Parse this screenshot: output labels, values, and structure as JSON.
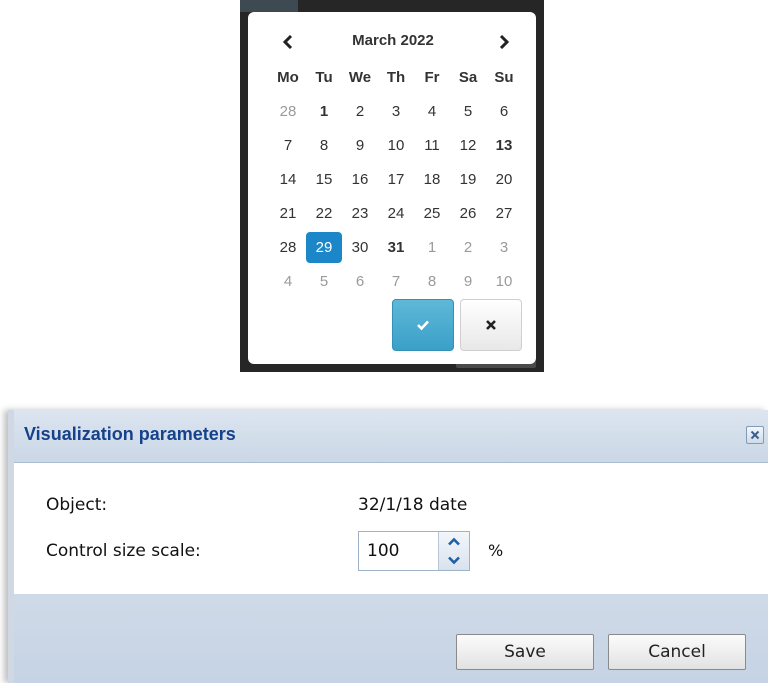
{
  "datepicker": {
    "month_title": "March 2022",
    "prev_icon": "chevron-left-icon",
    "next_icon": "chevron-right-icon",
    "weekdays": [
      "Mo",
      "Tu",
      "We",
      "Th",
      "Fr",
      "Sa",
      "Su"
    ],
    "weeks": [
      [
        "28",
        "1",
        "2",
        "3",
        "4",
        "5",
        "6"
      ],
      [
        "7",
        "8",
        "9",
        "10",
        "11",
        "12",
        "13"
      ],
      [
        "14",
        "15",
        "16",
        "17",
        "18",
        "19",
        "20"
      ],
      [
        "21",
        "22",
        "23",
        "24",
        "25",
        "26",
        "27"
      ],
      [
        "28",
        "29",
        "30",
        "31",
        "1",
        "2",
        "3"
      ],
      [
        "4",
        "5",
        "6",
        "7",
        "8",
        "9",
        "10"
      ]
    ],
    "selected_day": "29",
    "confirm_icon": "checkmark-icon",
    "close_icon": "close-icon",
    "colors": {
      "selected": "#1b87c9",
      "confirm": "#3aa0c8",
      "muted": "#9a9a9a"
    }
  },
  "dialog": {
    "title": "Visualization parameters",
    "close_icon": "close-icon",
    "object_label": "Object:",
    "object_value": "32/1/18 date",
    "scale_label": "Control size scale:",
    "scale_value": "100",
    "scale_unit": "%",
    "save_label": "Save",
    "cancel_label": "Cancel",
    "colors": {
      "title": "#15428b",
      "titlebar": "#cbd7e6",
      "footer": "#c5d3e4"
    }
  }
}
